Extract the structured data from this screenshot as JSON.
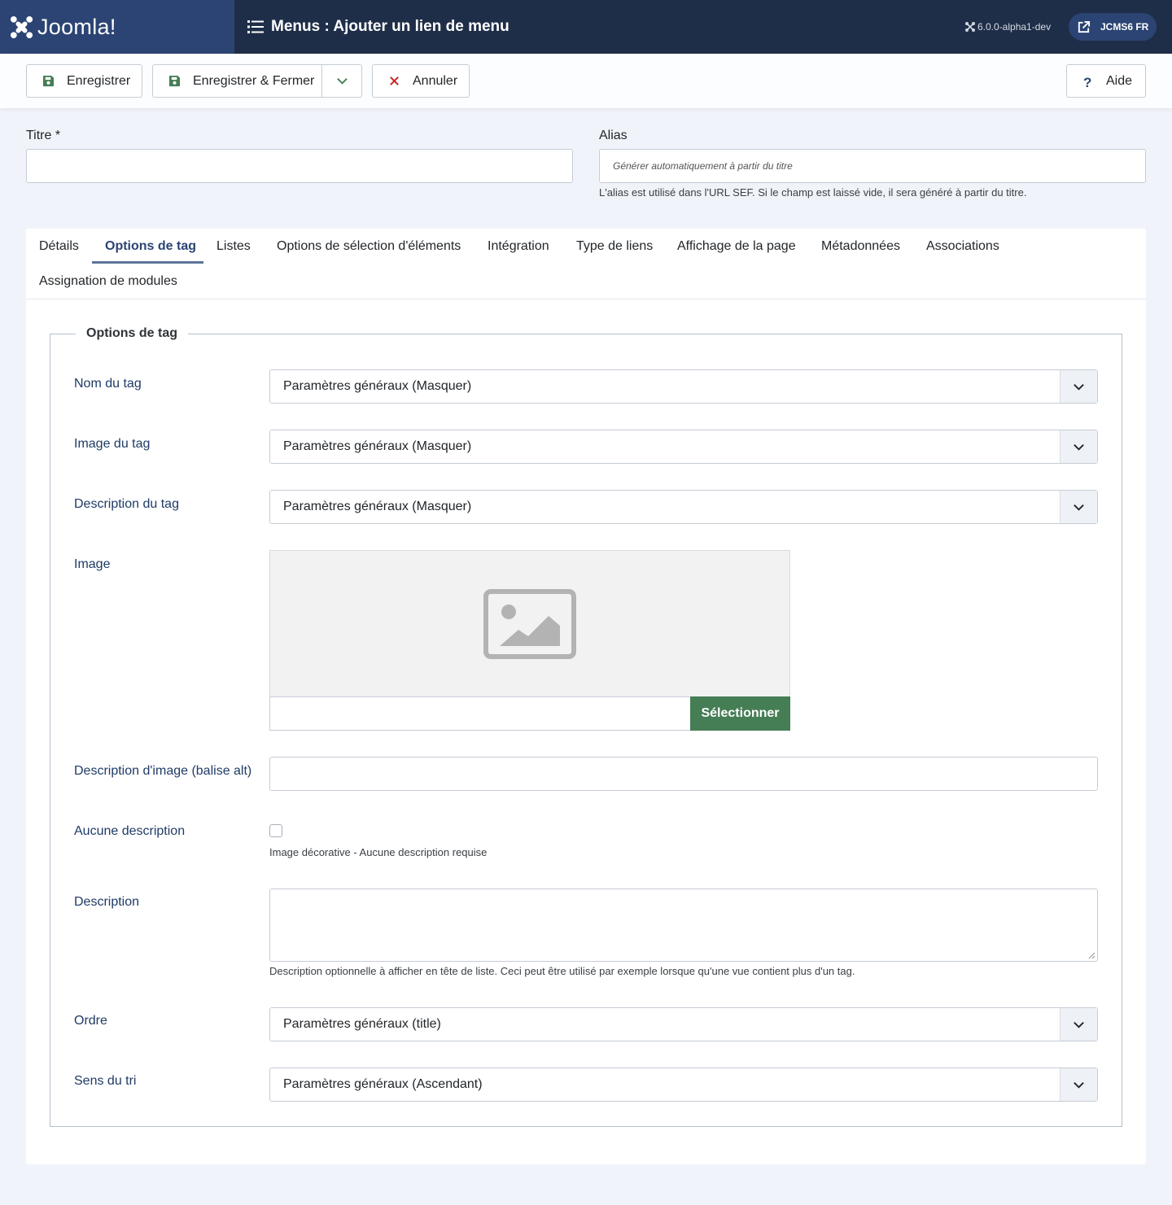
{
  "header": {
    "logo_text": "Joomla!",
    "page_title": "Menus : Ajouter un lien de menu",
    "version": "6.0.0-alpha1-dev",
    "site_button": "JCMS6 FR"
  },
  "toolbar": {
    "save_label": "Enregistrer",
    "save_close_label": "Enregistrer & Fermer",
    "cancel_label": "Annuler",
    "help_label": "Aide"
  },
  "form": {
    "title_label": "Titre *",
    "title_value": "",
    "alias_label": "Alias",
    "alias_placeholder": "Générer automatiquement à partir du titre",
    "alias_hint": "L'alias est utilisé dans l'URL SEF. Si le champ est laissé vide, il sera généré à partir du titre."
  },
  "tabs": [
    {
      "label": "Détails",
      "active": false
    },
    {
      "label": "Options de tag",
      "active": true
    },
    {
      "label": "Listes",
      "active": false
    },
    {
      "label": "Options de sélection d'éléments",
      "active": false
    },
    {
      "label": "Intégration",
      "active": false
    },
    {
      "label": "Type de liens",
      "active": false
    },
    {
      "label": "Affichage de la page",
      "active": false
    },
    {
      "label": "Métadonnées",
      "active": false
    },
    {
      "label": "Associations",
      "active": false
    },
    {
      "label": "Assignation de modules",
      "active": false
    }
  ],
  "fieldset": {
    "legend": "Options de tag",
    "tag_name": {
      "label": "Nom du tag",
      "value": "Paramètres généraux (Masquer)"
    },
    "tag_image": {
      "label": "Image du tag",
      "value": "Paramètres généraux (Masquer)"
    },
    "tag_description": {
      "label": "Description du tag",
      "value": "Paramètres généraux (Masquer)"
    },
    "image": {
      "label": "Image",
      "select_label": "Sélectionner",
      "value": ""
    },
    "image_alt": {
      "label": "Description d'image (balise alt)",
      "value": ""
    },
    "no_description": {
      "label": "Aucune description",
      "checked": false,
      "hint": "Image décorative - Aucune description requise"
    },
    "description": {
      "label": "Description",
      "value": "",
      "hint": "Description optionnelle à afficher en tête de liste. Ceci peut être utilisé par exemple lorsque qu'une vue contient plus d'un tag."
    },
    "order": {
      "label": "Ordre",
      "value": "Paramètres généraux (title)"
    },
    "sort_direction": {
      "label": "Sens du tri",
      "value": "Paramètres généraux (Ascendant)"
    }
  },
  "colors": {
    "header_bg": "#1f2e48",
    "brand_bg": "#2b4473",
    "save_icon": "#457d54",
    "cancel_icon": "#c52827",
    "select_button": "#457d54"
  },
  "icons": {
    "logo": "joomla-logo-icon",
    "menu_list": "list-icon",
    "version": "joomla-small-icon",
    "site": "external-link-icon",
    "save": "floppy-disk-icon",
    "dropdown": "chevron-down-icon",
    "cancel": "close-icon",
    "help": "question-icon",
    "image_placeholder": "image-placeholder-icon"
  }
}
